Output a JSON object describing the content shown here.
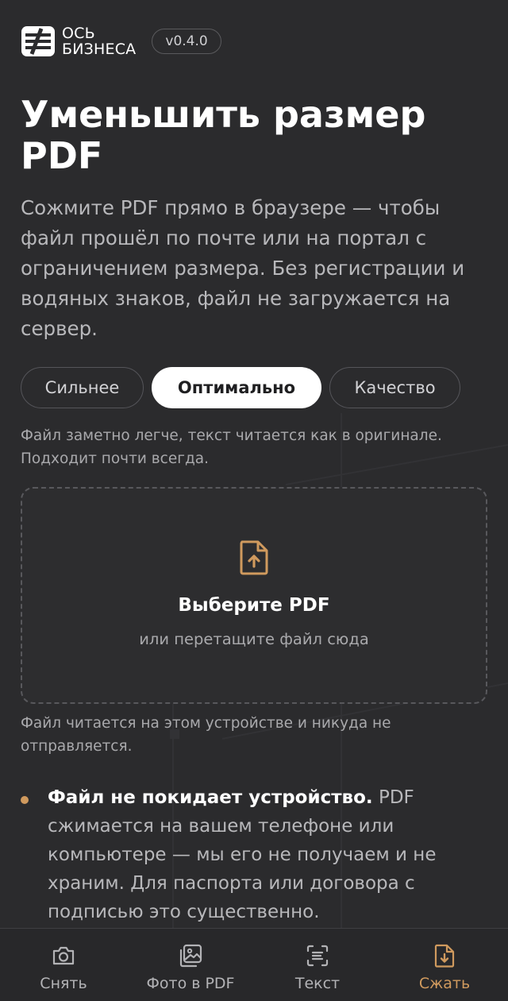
{
  "header": {
    "logo_line1": "ОСЬ",
    "logo_line2": "БИЗНЕСА",
    "version": "v0.4.0"
  },
  "page": {
    "title": "Уменьшить размер PDF",
    "description": "Сожмите PDF прямо в браузере — чтобы файл прошёл по почте или на портал с ограничением размера. Без регистрации и водяных знаков, файл не загружается на сервер."
  },
  "modes": {
    "items": [
      {
        "label": "Сильнее",
        "active": false
      },
      {
        "label": "Оптимально",
        "active": true
      },
      {
        "label": "Качество",
        "active": false
      }
    ],
    "hint": "Файл заметно легче, текст читается как в оригинале. Подходит почти всегда."
  },
  "dropzone": {
    "icon": "file-upload-icon",
    "title": "Выберите PDF",
    "subtitle": "или перетащите файл сюда",
    "note": "Файл читается на этом устройстве и никуда не отправляется."
  },
  "feature": {
    "bold": "Файл не покидает устройство.",
    "text": " PDF сжимается на вашем телефоне или компьютере — мы его не получаем и не храним. Для паспорта или договора с подписью это существенно."
  },
  "tabbar": {
    "items": [
      {
        "label": "Снять",
        "icon": "camera-icon",
        "active": false
      },
      {
        "label": "Фото в PDF",
        "icon": "images-icon",
        "active": false
      },
      {
        "label": "Текст",
        "icon": "scan-text-icon",
        "active": false
      },
      {
        "label": "Сжать",
        "icon": "file-download-icon",
        "active": true
      }
    ]
  },
  "colors": {
    "background": "#2b2b2d",
    "accent": "#d09a5e",
    "text_muted": "#b8b8bb"
  }
}
